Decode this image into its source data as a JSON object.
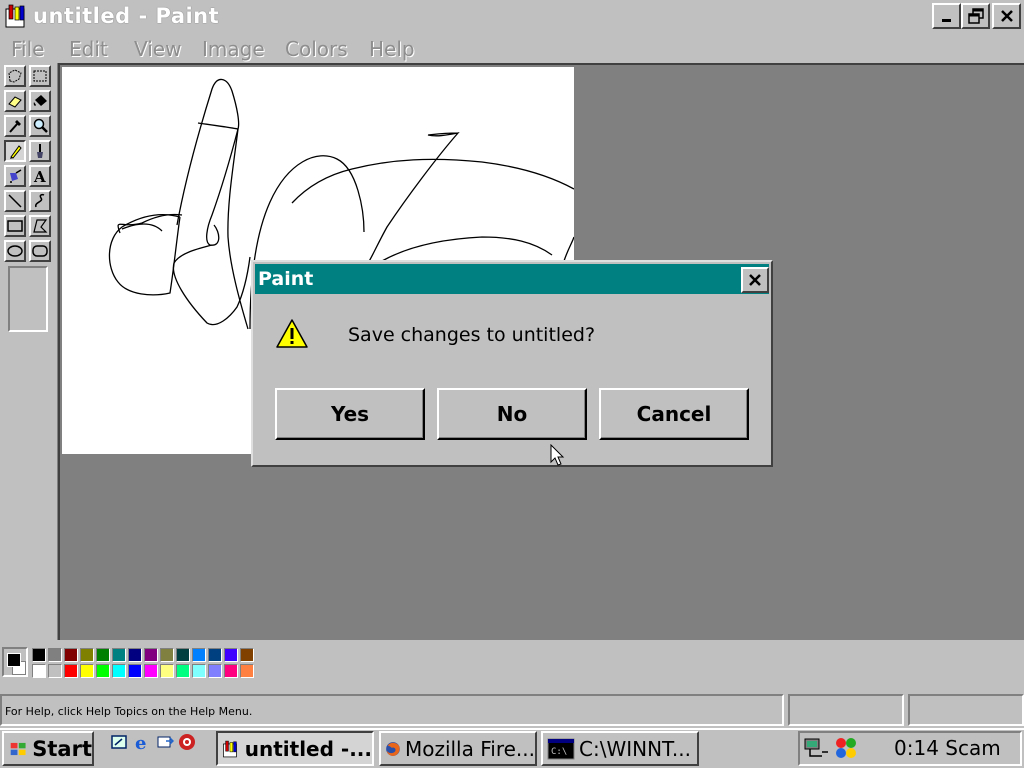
{
  "window": {
    "title": "untitled - Paint"
  },
  "menu": [
    "File",
    "Edit",
    "View",
    "Image",
    "Colors",
    "Help"
  ],
  "tools": [
    {
      "name": "free-form-select-icon"
    },
    {
      "name": "select-icon"
    },
    {
      "name": "eraser-icon"
    },
    {
      "name": "fill-bucket-icon"
    },
    {
      "name": "color-picker-icon"
    },
    {
      "name": "magnifier-icon"
    },
    {
      "name": "pencil-icon"
    },
    {
      "name": "brush-icon"
    },
    {
      "name": "airbrush-icon"
    },
    {
      "name": "text-icon",
      "glyph": "A"
    },
    {
      "name": "line-icon"
    },
    {
      "name": "curve-icon"
    },
    {
      "name": "rectangle-icon"
    },
    {
      "name": "polygon-icon"
    },
    {
      "name": "ellipse-icon"
    },
    {
      "name": "rounded-rectangle-icon"
    }
  ],
  "selected_tool": "pencil-icon",
  "palette": {
    "foreground": "#000000",
    "background": "#ffffff",
    "row1": [
      "#000000",
      "#808080",
      "#800000",
      "#808000",
      "#008000",
      "#008080",
      "#000080",
      "#800080",
      "#808040",
      "#004040",
      "#0080ff",
      "#004080",
      "#4000ff",
      "#804000"
    ],
    "row2": [
      "#ffffff",
      "#c0c0c0",
      "#ff0000",
      "#ffff00",
      "#00ff00",
      "#00ffff",
      "#0000ff",
      "#ff00ff",
      "#ffff80",
      "#00ff80",
      "#80ffff",
      "#8080ff",
      "#ff0080",
      "#ff8040"
    ]
  },
  "status": {
    "help_text": "For Help, click Help Topics on the Help Menu."
  },
  "taskbar": {
    "start_label": "Start",
    "quick_launch": [
      "show-desktop-icon",
      "internet-explorer-icon",
      "outlook-express-icon",
      "realplayer-icon"
    ],
    "tasks": [
      {
        "label": "untitled -...",
        "icon": "paint-icon",
        "active": true
      },
      {
        "label": "Mozilla Fire...",
        "icon": "firefox-icon",
        "active": false
      },
      {
        "label": "C:\\WINNT...",
        "icon": "console-icon",
        "active": false
      }
    ],
    "tray_icons": [
      "network-icon",
      "msn-messenger-icon"
    ],
    "clock": "0:14 Scam"
  },
  "dialog": {
    "title": "Paint",
    "message": "Save changes to untitled?",
    "buttons": [
      "Yes",
      "No",
      "Cancel"
    ]
  }
}
